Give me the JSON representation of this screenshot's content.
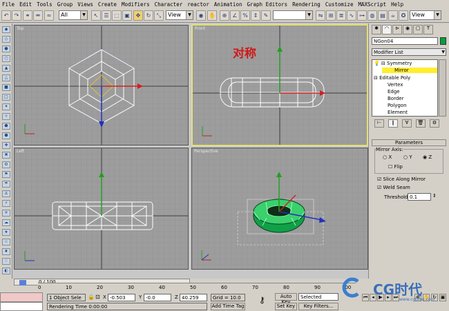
{
  "menubar": {
    "items": [
      "File",
      "Edit",
      "Tools",
      "Group",
      "Views",
      "Create",
      "Modifiers",
      "Character",
      "reactor",
      "Animation",
      "Graph Editors",
      "Rendering",
      "Customize",
      "MAXScript",
      "Help"
    ]
  },
  "toolbar": {
    "selection_filter": "All",
    "reference_coord": "View",
    "view_dropdown_right": "View"
  },
  "viewports": {
    "top": {
      "label": "Top"
    },
    "front": {
      "label": "Front",
      "annotation": "对称"
    },
    "left": {
      "label": "Left"
    },
    "perspective": {
      "label": "Perspective"
    }
  },
  "command_panel": {
    "object_name": "NGon04",
    "object_color": "#00a040",
    "modifier_list_label": "Modifier List",
    "stack": {
      "symmetry": "Symmetry",
      "mirror": "Mirror",
      "editable_poly": "Editable Poly",
      "vertex": "Vertex",
      "edge": "Edge",
      "border": "Border",
      "polygon": "Polygon",
      "element": "Element"
    },
    "parameters": {
      "rollout_title": "Parameters",
      "mirror_axis_label": "Mirror Axis:",
      "axis_x": "X",
      "axis_y": "Y",
      "axis_z": "Z",
      "selected_axis": "Z",
      "flip_label": "Flip",
      "flip_checked": false,
      "slice_label": "Slice Along Mirror",
      "slice_checked": true,
      "weld_label": "Weld Seam",
      "weld_checked": true,
      "threshold_label": "Threshold:",
      "threshold_value": "0.1"
    }
  },
  "timeline": {
    "frame_display": "0 / 100",
    "ticks": [
      "0",
      "10",
      "20",
      "30",
      "40",
      "50",
      "60",
      "70",
      "80",
      "90",
      "100"
    ]
  },
  "statusbar": {
    "selection_info": "1 Object Sele",
    "x_label": "X",
    "x_value": "-0.503",
    "y_label": "Y",
    "y_value": "-0.0",
    "z_label": "Z",
    "z_value": "40.259",
    "grid": "Grid = 10.0",
    "rendering_time": "Rendering Time  0:00:00",
    "add_time_tag": "Add Time Tag",
    "auto_key": "Auto Key",
    "set_key": "Set Key",
    "selected_dropdown": "Selected",
    "key_filters": "Key Filters...",
    "watermark_brand": "CG时代",
    "watermark_url": "www.cgtime.com"
  }
}
